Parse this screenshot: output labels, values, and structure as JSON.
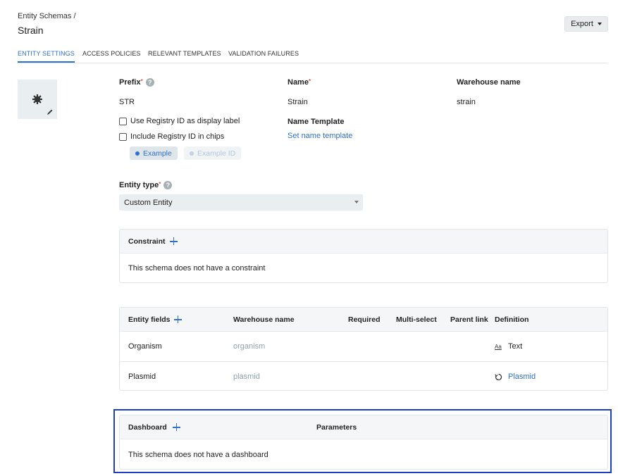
{
  "header": {
    "breadcrumb": "Entity Schemas /",
    "title": "Strain",
    "export_label": "Export"
  },
  "tabs": [
    {
      "label": "ENTITY SETTINGS",
      "active": true
    },
    {
      "label": "ACCESS POLICIES",
      "active": false
    },
    {
      "label": "RELEVANT TEMPLATES",
      "active": false
    },
    {
      "label": "VALIDATION FAILURES",
      "active": false
    }
  ],
  "settings": {
    "prefix_label": "Prefix",
    "prefix_value": "STR",
    "name_label": "Name",
    "name_value": "Strain",
    "warehouse_label": "Warehouse name",
    "warehouse_value": "strain",
    "required_mark": "*",
    "help_glyph": "?",
    "use_registry_id_label": "Use Registry ID as display label",
    "include_registry_id_label": "Include Registry ID in chips",
    "chip_example": "Example",
    "chip_example_id": "Example ID",
    "name_template_label": "Name Template",
    "name_template_link": "Set name template",
    "entity_type_label": "Entity type",
    "entity_type_value": "Custom Entity"
  },
  "constraint": {
    "title": "Constraint",
    "empty_text": "This schema does not have a constraint"
  },
  "entity_fields": {
    "columns": [
      "Entity fields",
      "Warehouse name",
      "Required",
      "Multi-select",
      "Parent link",
      "Definition"
    ],
    "rows": [
      {
        "name": "Organism",
        "warehouse": "organism",
        "definition": "Text",
        "definition_icon": "text-type-icon",
        "definition_is_link": false
      },
      {
        "name": "Plasmid",
        "warehouse": "plasmid",
        "definition": "Plasmid",
        "definition_icon": "entity-link-icon",
        "definition_is_link": true
      }
    ],
    "text_icon_glyph": "Aa"
  },
  "dashboard": {
    "title": "Dashboard",
    "parameters_label": "Parameters",
    "empty_text": "This schema does not have a dashboard"
  },
  "colors": {
    "accent": "#2f6fd1",
    "required": "#d9534f",
    "highlight_border": "#1f3ec8",
    "muted_text": "#8ea3ab"
  }
}
